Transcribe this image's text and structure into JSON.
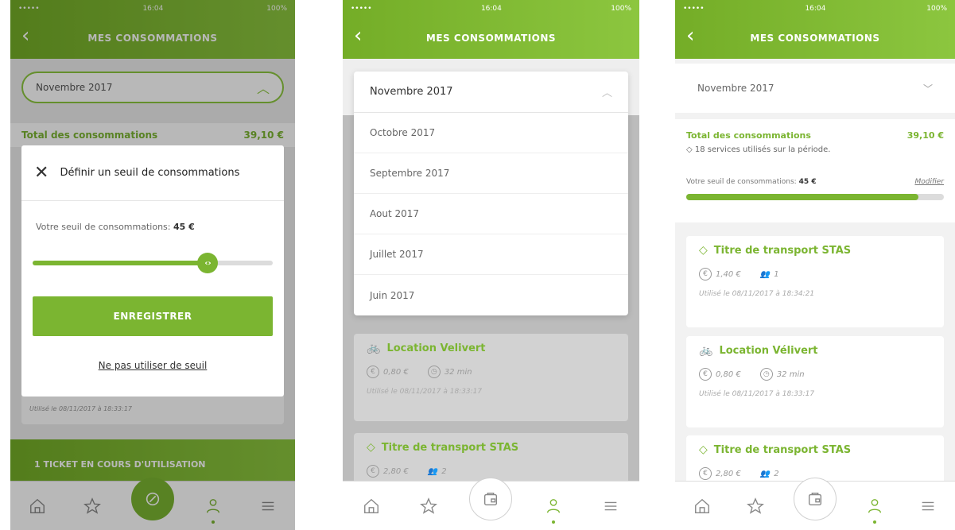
{
  "status": {
    "carrier": "•••••",
    "time": "16:04",
    "battery": "100%"
  },
  "nav": {
    "title": "MES CONSOMMATIONS"
  },
  "tabs": [
    "home",
    "favorites",
    "services",
    "account",
    "menu"
  ],
  "colors": {
    "accent": "#7bb531"
  },
  "phone1": {
    "nav_title": "MES CONSOMMATIONS",
    "month": "Novembre 2017",
    "total_label": "Total des consommations",
    "total_value": "39,10 €",
    "modal": {
      "title": "Définir un seuil de consommations",
      "seuil_label": "Votre seuil de consommations:",
      "seuil_value": "45 €",
      "slider_fraction": 0.73,
      "thumb_glyph": "‹›",
      "save_label": "ENREGISTRER",
      "no_threshold_label": "Ne pas utiliser de seuil"
    },
    "bg_card_date": "Utilisé le 08/11/2017 à 18:33:17",
    "ticket_bar": "1 TICKET EN COURS D'UTILISATION"
  },
  "phone2": {
    "selected": "Novembre 2017",
    "options": [
      "Octobre 2017",
      "Septembre 2017",
      "Aout 2017",
      "Juillet 2017",
      "Juin 2017"
    ],
    "cards": [
      {
        "title": "Location Velivert",
        "icon": "bike-icon",
        "price": "0,80 €",
        "duration": "32 min",
        "date": "Utilisé le 08/11/2017 à 18:33:17"
      },
      {
        "title": "Titre de transport STAS",
        "icon": "ticket-icon",
        "price": "2,80 €",
        "count": "2"
      }
    ]
  },
  "phone3": {
    "month": "Novembre 2017",
    "total_label": "Total des consommations",
    "total_value": "39,10 €",
    "services": "18 services utilisés sur la période.",
    "seuil_label": "Votre seuil de consommations:",
    "seuil_value": "45 €",
    "modify": "Modifier",
    "progress_fraction": 0.9,
    "cards": [
      {
        "title": "Titre de transport STAS",
        "price": "1,40 €",
        "count": "1",
        "date": "Utilisé le 08/11/2017 à 18:34:21"
      },
      {
        "title": "Location Vélivert",
        "price": "0,80 €",
        "duration": "32 min",
        "date": "Utilisé le 08/11/2017 à 18:33:17"
      },
      {
        "title": "Titre de transport STAS",
        "price": "2,80 €",
        "count": "2"
      }
    ]
  }
}
